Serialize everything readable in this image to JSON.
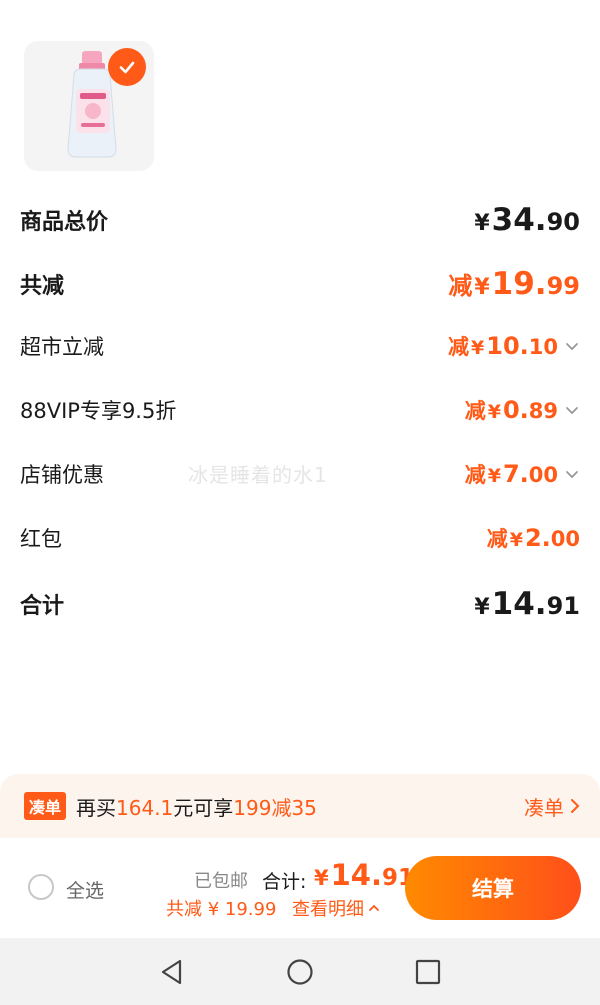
{
  "product": {
    "selected": true
  },
  "summary": {
    "goods_total": {
      "label": "商品总价",
      "yen": "¥",
      "int": "34.",
      "dec": "90"
    },
    "total_discount": {
      "label": "共减",
      "prefix": "减",
      "yen": "¥",
      "int": "19.",
      "dec": "99"
    },
    "supermarket": {
      "label": "超市立减",
      "prefix": "减",
      "yen": "¥",
      "int": "10.",
      "dec": "10"
    },
    "vip": {
      "label": "88VIP专享9.5折",
      "prefix": "减",
      "yen": "¥",
      "int": "0.",
      "dec": "89"
    },
    "shop": {
      "label": "店铺优惠",
      "prefix": "减",
      "yen": "¥",
      "int": "7.",
      "dec": "00"
    },
    "red_packet": {
      "label": "红包",
      "prefix": "减",
      "yen": "¥",
      "int": "2.",
      "dec": "00"
    },
    "sum": {
      "label": "合计",
      "yen": "¥",
      "int": "14.",
      "dec": "91"
    }
  },
  "watermark": "冰是睡着的水1",
  "promo": {
    "tag": "凑单",
    "part1": "再买",
    "amount": "164.1",
    "part2": "元可享",
    "deal": "199减35",
    "link": "凑单"
  },
  "bottom": {
    "select_all": "全选",
    "free_shipping": "已包邮",
    "total_label": "合计:",
    "total_yen": "¥",
    "total_int": "14.",
    "total_dec": "91",
    "saved": "共减 ¥ 19.99",
    "details": "查看明细",
    "checkout": "结算"
  },
  "colors": {
    "accent": "#ff5a17",
    "promo_bg": "#fdf4ee",
    "checkout_from": "#ff8a00",
    "checkout_to": "#ff4f1a"
  },
  "icons": [
    "check-icon",
    "chevron-down-icon",
    "chevron-right-icon",
    "chevron-up-icon",
    "nav-back-icon",
    "nav-home-icon",
    "nav-recents-icon"
  ]
}
